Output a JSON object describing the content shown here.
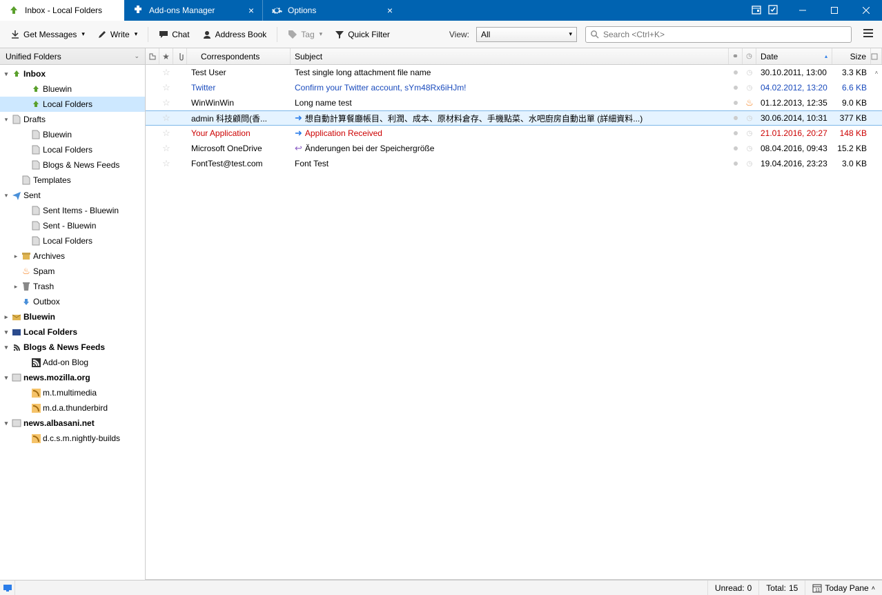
{
  "tabs": [
    {
      "label": "Inbox - Local Folders"
    },
    {
      "label": "Add-ons Manager"
    },
    {
      "label": "Options"
    }
  ],
  "toolbar": {
    "get_messages": "Get Messages",
    "write": "Write",
    "chat": "Chat",
    "address_book": "Address Book",
    "tag": "Tag",
    "quick_filter": "Quick Filter",
    "view_label": "View:",
    "view_value": "All",
    "search_placeholder": "Search <Ctrl+K>"
  },
  "folder_pane": {
    "header": "Unified Folders",
    "items": [
      {
        "label": "Inbox",
        "twisty": "▾",
        "icon": "inbox",
        "bold": true
      },
      {
        "label": "Bluewin",
        "indent": 2,
        "icon": "inbox"
      },
      {
        "label": "Local Folders",
        "indent": 2,
        "icon": "inbox",
        "selected": true
      },
      {
        "label": "Drafts",
        "twisty": "▾",
        "icon": "doc"
      },
      {
        "label": "Bluewin",
        "indent": 2,
        "icon": "doc"
      },
      {
        "label": "Local Folders",
        "indent": 2,
        "icon": "doc"
      },
      {
        "label": "Blogs & News Feeds",
        "indent": 2,
        "icon": "doc"
      },
      {
        "label": "Templates",
        "icon": "doc",
        "indent": 1
      },
      {
        "label": "Sent",
        "twisty": "▾",
        "icon": "sent"
      },
      {
        "label": "Sent Items - Bluewin",
        "indent": 2,
        "icon": "doc"
      },
      {
        "label": "Sent - Bluewin",
        "indent": 2,
        "icon": "doc"
      },
      {
        "label": "Local Folders",
        "indent": 2,
        "icon": "doc"
      },
      {
        "label": "Archives",
        "twisty": "▸",
        "icon": "archive",
        "indent": 1
      },
      {
        "label": "Spam",
        "icon": "flame",
        "indent": 1
      },
      {
        "label": "Trash",
        "twisty": "▸",
        "icon": "trash",
        "indent": 1
      },
      {
        "label": "Outbox",
        "icon": "outbox",
        "indent": 1
      },
      {
        "label": "Bluewin",
        "twisty": "▸",
        "icon": "mailbox",
        "bold": true
      },
      {
        "label": "Local Folders",
        "twisty": "▾",
        "icon": "localfolder",
        "bold": true
      },
      {
        "label": "Blogs & News Feeds",
        "twisty": "▾",
        "icon": "rss",
        "bold": true
      },
      {
        "label": "Add-on Blog",
        "indent": 2,
        "icon": "feed"
      },
      {
        "label": "news.mozilla.org",
        "twisty": "▾",
        "icon": "news",
        "bold": true
      },
      {
        "label": "m.t.multimedia",
        "indent": 2,
        "icon": "feeditem"
      },
      {
        "label": "m.d.a.thunderbird",
        "indent": 2,
        "icon": "feeditem"
      },
      {
        "label": "news.albasani.net",
        "twisty": "▾",
        "icon": "news",
        "bold": true
      },
      {
        "label": "d.c.s.m.nightly-builds",
        "indent": 2,
        "icon": "feeditem"
      }
    ]
  },
  "columns": {
    "correspondents": "Correspondents",
    "subject": "Subject",
    "date": "Date",
    "size": "Size"
  },
  "messages": [
    {
      "from": "Test User",
      "subject": "Test single long attachment file name",
      "date": "30.10.2011, 13:00",
      "size": "3.3 KB"
    },
    {
      "from": "Twitter",
      "subject": "Confirm your Twitter account, sYm48Rx6iHJm!",
      "date": "04.02.2012, 13:20",
      "size": "6.6 KB",
      "style": "link"
    },
    {
      "from": "WinWinWin",
      "subject": "Long name test",
      "date": "01.12.2013, 12:35",
      "size": "9.0 KB",
      "flame": true
    },
    {
      "from": "admin 科技顧問(香...",
      "subject": "想自動計算餐廳帳目、利潤、成本、原材料倉存、手機點菜、水吧廚房自動出單 (詳細資料...)",
      "date": "30.06.2014, 10:31",
      "size": "377 KB",
      "arrow": "fwd",
      "selected": true
    },
    {
      "from": "Your Application",
      "subject": "Application Received",
      "date": "21.01.2016, 20:27",
      "size": "148 KB",
      "style": "red",
      "arrow": "fwd"
    },
    {
      "from": "Microsoft OneDrive",
      "subject": "Änderungen bei der Speichergröße",
      "date": "08.04.2016, 09:43",
      "size": "15.2 KB",
      "arrow": "reply"
    },
    {
      "from": "FontTest@test.com",
      "subject": "Font Test",
      "date": "19.04.2016, 23:23",
      "size": "3.0 KB"
    }
  ],
  "status": {
    "unread_label": "Unread:",
    "unread_value": "0",
    "total_label": "Total:",
    "total_value": "15",
    "today_pane": "Today Pane"
  }
}
